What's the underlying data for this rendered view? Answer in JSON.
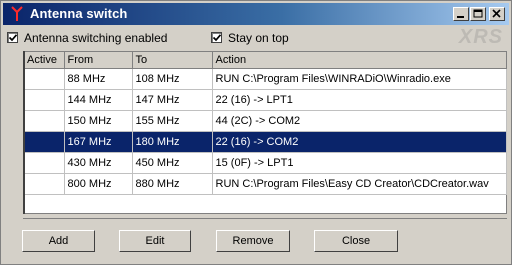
{
  "window": {
    "title": "Antenna switch",
    "brand": "XRS"
  },
  "options": {
    "switching_label": "Antenna switching enabled",
    "switching_checked": true,
    "stay_on_top_label": "Stay on top",
    "stay_on_top_checked": true
  },
  "table": {
    "columns": [
      "Active",
      "From",
      "To",
      "Action"
    ],
    "rows": [
      {
        "active": "",
        "from": "88 MHz",
        "to": "108 MHz",
        "action": "RUN C:\\Program Files\\WINRADiO\\Winradio.exe",
        "selected": false
      },
      {
        "active": "",
        "from": "144 MHz",
        "to": "147 MHz",
        "action": "22 (16) -> LPT1",
        "selected": false
      },
      {
        "active": "",
        "from": "150 MHz",
        "to": "155 MHz",
        "action": "44 (2C) -> COM2",
        "selected": false
      },
      {
        "active": "",
        "from": "167 MHz",
        "to": "180 MHz",
        "action": "22 (16) -> COM2",
        "selected": true
      },
      {
        "active": "",
        "from": "430 MHz",
        "to": "450 MHz",
        "action": "15 (0F) -> LPT1",
        "selected": false
      },
      {
        "active": "",
        "from": "800 MHz",
        "to": "880 MHz",
        "action": "RUN C:\\Program Files\\Easy CD Creator\\CDCreator.wav",
        "selected": false
      }
    ]
  },
  "buttons": {
    "add": "Add",
    "edit": "Edit",
    "remove": "Remove",
    "close": "Close"
  },
  "colors": {
    "title_bar": "#0a246a",
    "selection": "#0a246a",
    "face": "#d4d0c8"
  }
}
